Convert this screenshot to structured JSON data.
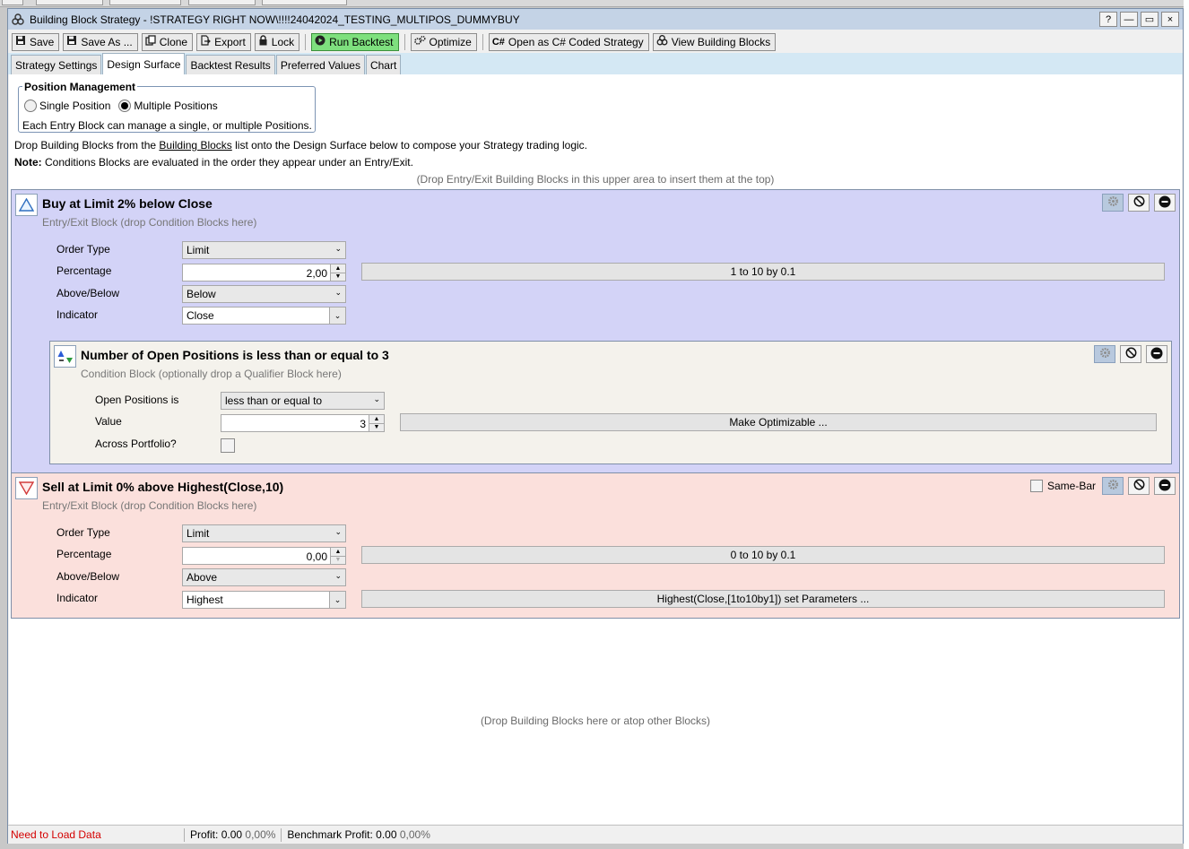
{
  "window": {
    "title": "Building Block Strategy - !STRATEGY RIGHT NOW\\!!!!24042024_TESTING_MULTIPOS_DUMMYBUY",
    "controls": [
      "?",
      "—",
      "▭",
      "×"
    ]
  },
  "toolbar": {
    "save": "Save",
    "save_as": "Save As ...",
    "clone": "Clone",
    "export": "Export",
    "lock": "Lock",
    "run_backtest": "Run Backtest",
    "optimize": "Optimize",
    "open_csharp": "Open as C# Coded Strategy",
    "view_blocks": "View Building Blocks"
  },
  "tabs": [
    "Strategy Settings",
    "Design Surface",
    "Backtest Results",
    "Preferred Values",
    "Chart"
  ],
  "position_management": {
    "legend": "Position Management",
    "single": "Single Position",
    "multiple": "Multiple Positions",
    "note": "Each Entry Block can manage a single, or multiple Positions."
  },
  "info": {
    "line1_pre": "Drop Building Blocks from the ",
    "line1_link": "Building Blocks",
    "line1_post": " list onto the Design Surface below to compose your Strategy trading logic.",
    "note_label": "Note:",
    "note_text": " Conditions Blocks are evaluated in the order they appear under an Entry/Exit.",
    "upper_hint": "(Drop Entry/Exit Building Blocks in this upper area to insert them at the top)",
    "lower_hint": "(Drop Building Blocks here or atop other Blocks)"
  },
  "buy_block": {
    "title": "Buy at Limit 2% below Close",
    "subtitle": "Entry/Exit Block (drop Condition Blocks here)",
    "order_type_label": "Order Type",
    "order_type": "Limit",
    "percentage_label": "Percentage",
    "percentage": "2,00",
    "percentage_range": "1 to 10 by 0.1",
    "above_below_label": "Above/Below",
    "above_below": "Below",
    "indicator_label": "Indicator",
    "indicator": "Close"
  },
  "condition_block": {
    "title": "Number of Open Positions is less than or equal to 3",
    "subtitle": "Condition Block (optionally drop a Qualifier Block here)",
    "open_positions_label": "Open Positions is",
    "open_positions": "less than or equal to",
    "value_label": "Value",
    "value": "3",
    "make_optimizable": "Make Optimizable ...",
    "across_label": "Across Portfolio?"
  },
  "sell_block": {
    "title": "Sell at Limit 0% above Highest(Close,10)",
    "subtitle": "Entry/Exit Block (drop Condition Blocks here)",
    "same_bar": "Same-Bar",
    "order_type_label": "Order Type",
    "order_type": "Limit",
    "percentage_label": "Percentage",
    "percentage": "0,00",
    "percentage_range": "0 to 10 by 0.1",
    "above_below_label": "Above/Below",
    "above_below": "Above",
    "indicator_label": "Indicator",
    "indicator": "Highest",
    "indicator_params": "Highest(Close,[1to10by1]) set Parameters ..."
  },
  "status": {
    "error": "Need to Load Data",
    "profit_label": "Profit:",
    "profit": "0.00",
    "profit_pct": "0,00%",
    "bench_label": "Benchmark Profit:",
    "bench": "0.00",
    "bench_pct": "0,00%"
  }
}
